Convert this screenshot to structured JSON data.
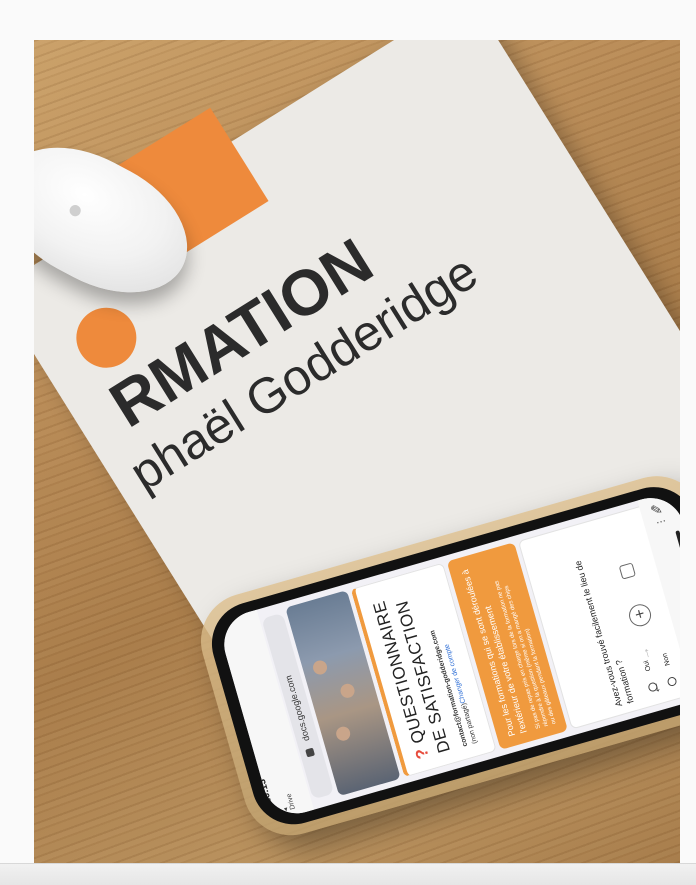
{
  "mousepad": {
    "brand_line1": "RMATION",
    "brand_line2": "phaël Godderidge",
    "accent_color": "#ee8a3c"
  },
  "phone": {
    "status_time": "16:13",
    "back_label": "◂ Drive",
    "url": "docs.google.com",
    "form": {
      "title_mark": "?",
      "title_line1": "QUESTIONNAIRE",
      "title_line2": "DE SATISFACTION",
      "account_email": "contact@formation-godderidge.com",
      "account_note": "(non partagé)",
      "switch_account": "Changer de compte",
      "orange_heading_1": "Pour les formations qui se sont déroulées à",
      "orange_heading_2": "l'extérieur de votre établissement",
      "orange_body_1": "Si pas de repas pris en charge lors de la formation ne pas",
      "orange_body_2": "répondre à la question (même si on a mangé des chips",
      "orange_body_3": "ou des gâteaux pendant la formation)",
      "question_1": "Avez-vous trouvé facilement le lieu de",
      "question_2": "formation ?",
      "option_yes": "Oui",
      "option_no": "Non"
    },
    "icons": [
      "lock-icon",
      "plus-icon",
      "tabs-icon",
      "share-icon",
      "back-arrow-icon",
      "forward-arrow-icon",
      "more-icon",
      "edit-icon"
    ]
  }
}
